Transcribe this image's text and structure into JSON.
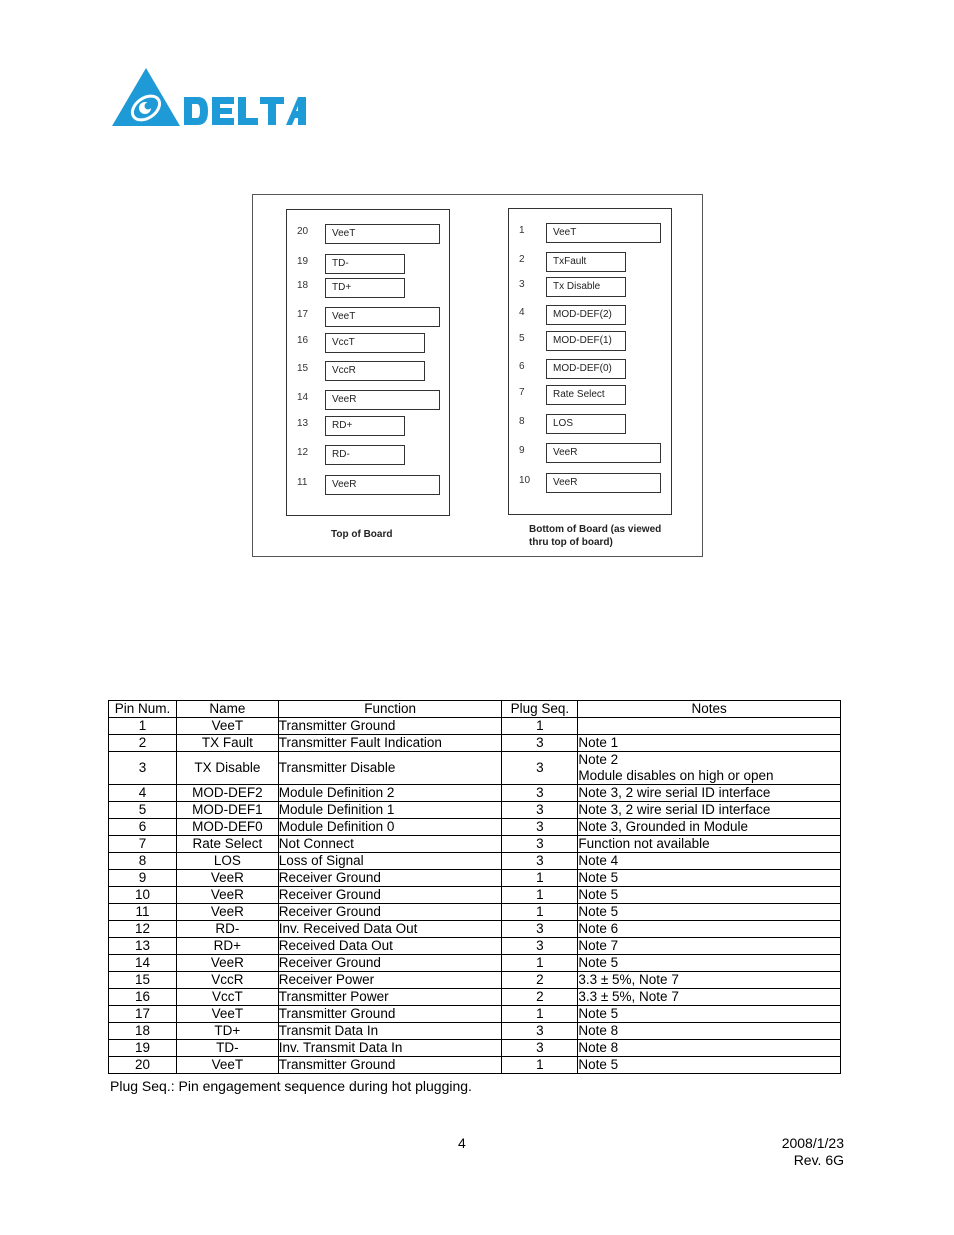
{
  "header": {
    "logo_icon": "delta-triangle-logo",
    "logo_text": "DELTA",
    "brand_color": "#1e9ad6"
  },
  "figure": {
    "top_board": {
      "caption": "Top of Board",
      "pins": [
        {
          "num": "20",
          "label": "VeeT",
          "size": "long"
        },
        {
          "num": "19",
          "label": "TD-",
          "size": "short"
        },
        {
          "num": "18",
          "label": "TD+",
          "size": "short"
        },
        {
          "num": "17",
          "label": "VeeT",
          "size": "long"
        },
        {
          "num": "16",
          "label": "VccT",
          "size": "mid"
        },
        {
          "num": "15",
          "label": "VccR",
          "size": "mid"
        },
        {
          "num": "14",
          "label": "VeeR",
          "size": "long"
        },
        {
          "num": "13",
          "label": "RD+",
          "size": "short"
        },
        {
          "num": "12",
          "label": "RD-",
          "size": "short"
        },
        {
          "num": "11",
          "label": "VeeR",
          "size": "long"
        }
      ]
    },
    "bottom_board": {
      "caption_line1": "Bottom of Board (as viewed",
      "caption_line2": "thru top of board)",
      "pins": [
        {
          "num": "1",
          "label": "VeeT",
          "size": "long"
        },
        {
          "num": "2",
          "label": "TxFault",
          "size": "short"
        },
        {
          "num": "3",
          "label": "Tx Disable",
          "size": "short"
        },
        {
          "num": "4",
          "label": "MOD-DEF(2)",
          "size": "short"
        },
        {
          "num": "5",
          "label": "MOD-DEF(1)",
          "size": "short"
        },
        {
          "num": "6",
          "label": "MOD-DEF(0)",
          "size": "short"
        },
        {
          "num": "7",
          "label": "Rate Select",
          "size": "short"
        },
        {
          "num": "8",
          "label": "LOS",
          "size": "short"
        },
        {
          "num": "9",
          "label": "VeeR",
          "size": "long"
        },
        {
          "num": "10",
          "label": "VeeR",
          "size": "long"
        }
      ]
    }
  },
  "table": {
    "headers": [
      "Pin Num.",
      "Name",
      "Function",
      "Plug Seq.",
      "Notes"
    ],
    "rows": [
      {
        "pin": "1",
        "name": "VeeT",
        "function": "Transmitter Ground",
        "seq": "1",
        "notes": ""
      },
      {
        "pin": "2",
        "name": "TX Fault",
        "function": "Transmitter Fault Indication",
        "seq": "3",
        "notes": "Note 1"
      },
      {
        "pin": "3",
        "name": "TX Disable",
        "function": "Transmitter Disable",
        "seq": "3",
        "notes": "Note 2",
        "notes2": "Module disables on high or open"
      },
      {
        "pin": "4",
        "name": "MOD-DEF2",
        "function": "Module Definition 2",
        "seq": "3",
        "notes": "Note 3, 2 wire serial ID interface"
      },
      {
        "pin": "5",
        "name": "MOD-DEF1",
        "function": "Module Definition 1",
        "seq": "3",
        "notes": "Note 3, 2 wire serial ID interface"
      },
      {
        "pin": "6",
        "name": "MOD-DEF0",
        "function": "Module Definition 0",
        "seq": "3",
        "notes": "Note 3, Grounded in Module"
      },
      {
        "pin": "7",
        "name": "Rate Select",
        "function": "Not Connect",
        "seq": "3",
        "notes": "Function not available"
      },
      {
        "pin": "8",
        "name": "LOS",
        "function": "Loss of Signal",
        "seq": "3",
        "notes": "Note 4"
      },
      {
        "pin": "9",
        "name": "VeeR",
        "function": "Receiver Ground",
        "seq": "1",
        "notes": "Note 5"
      },
      {
        "pin": "10",
        "name": "VeeR",
        "function": "Receiver Ground",
        "seq": "1",
        "notes": "Note 5"
      },
      {
        "pin": "11",
        "name": "VeeR",
        "function": "Receiver Ground",
        "seq": "1",
        "notes": "Note 5"
      },
      {
        "pin": "12",
        "name": "RD-",
        "function": "Inv. Received Data Out",
        "seq": "3",
        "notes": "Note 6"
      },
      {
        "pin": "13",
        "name": "RD+",
        "function": "Received Data Out",
        "seq": "3",
        "notes": "Note 7"
      },
      {
        "pin": "14",
        "name": "VeeR",
        "function": "Receiver Ground",
        "seq": "1",
        "notes": "Note 5"
      },
      {
        "pin": "15",
        "name": "VccR",
        "function": "Receiver Power",
        "seq": "2",
        "notes": "3.3 ± 5%, Note 7"
      },
      {
        "pin": "16",
        "name": "VccT",
        "function": "Transmitter Power",
        "seq": "2",
        "notes": "3.3 ± 5%, Note 7"
      },
      {
        "pin": "17",
        "name": "VeeT",
        "function": "Transmitter Ground",
        "seq": "1",
        "notes": "Note 5"
      },
      {
        "pin": "18",
        "name": "TD+",
        "function": "Transmit Data In",
        "seq": "3",
        "notes": "Note 8"
      },
      {
        "pin": "19",
        "name": "TD-",
        "function": "Inv. Transmit Data In",
        "seq": "3",
        "notes": "Note 8"
      },
      {
        "pin": "20",
        "name": "VeeT",
        "function": "Transmitter Ground",
        "seq": "1",
        "notes": "Note 5"
      }
    ]
  },
  "footnote": "Plug Seq.: Pin engagement sequence during hot plugging.",
  "footer": {
    "page_number": "4",
    "date": "2008/1/23",
    "revision": "Rev. 6G"
  }
}
